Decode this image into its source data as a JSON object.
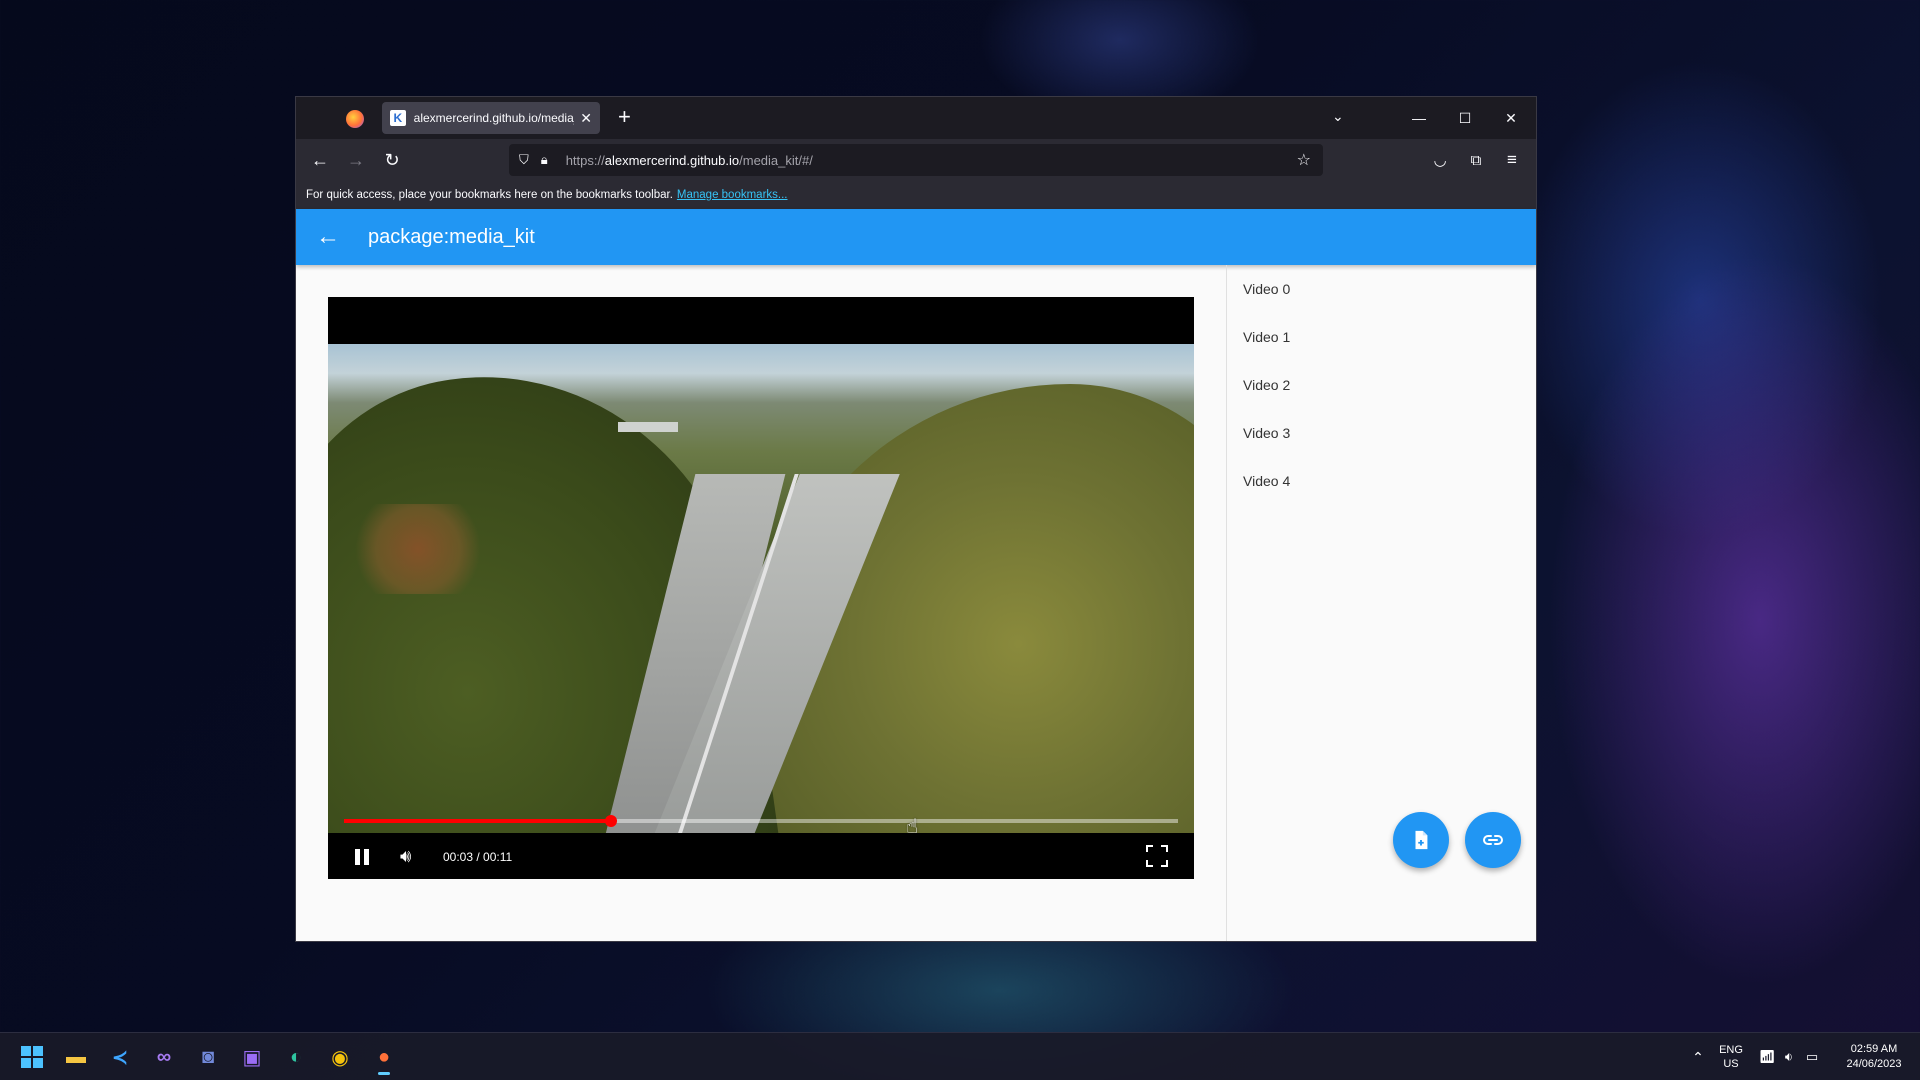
{
  "browser": {
    "tab": {
      "title": "alexmercerind.github.io/media_kit/#/"
    },
    "url": {
      "prefix": "https://",
      "host": "alexmercerind.github.io",
      "path": "/media_kit/#/"
    },
    "bookmarks_bar": {
      "message": "For quick access, place your bookmarks here on the bookmarks toolbar.",
      "link_label": "Manage bookmarks..."
    },
    "icons": {
      "firefox": "firefox-logo-icon",
      "tab_close": "close-icon",
      "new_tab": "plus-icon",
      "list_tabs": "chevron-down-icon",
      "back": "arrow-left-icon",
      "forward": "arrow-right-icon",
      "reload": "reload-icon",
      "shield": "shield-icon",
      "lock": "lock-icon",
      "bookmark": "star-icon",
      "pocket": "pocket-icon",
      "extensions": "puzzle-icon",
      "menu": "hamburger-menu-icon"
    }
  },
  "app": {
    "title": "package:media_kit",
    "accent_color": "#2196f3",
    "player": {
      "current_time": "00:03",
      "total_time": "00:11",
      "time_display": "00:03 / 00:11",
      "progress_fraction": 0.32,
      "progress_color": "#ff0000"
    },
    "videos": [
      "Video 0",
      "Video 1",
      "Video 2",
      "Video 3",
      "Video 4"
    ],
    "fab_icons": [
      "file-icon",
      "link-icon"
    ]
  },
  "taskbar": {
    "apps": [
      "start-icon",
      "file-explorer-icon",
      "vscode-icon",
      "visual-studio-icon",
      "discord-icon",
      "visual-studio-preview-icon",
      "edge-icon",
      "chrome-icon",
      "firefox-icon"
    ],
    "language": {
      "line1": "ENG",
      "line2": "US"
    },
    "clock": {
      "time": "02:59 AM",
      "date": "24/06/2023"
    }
  }
}
